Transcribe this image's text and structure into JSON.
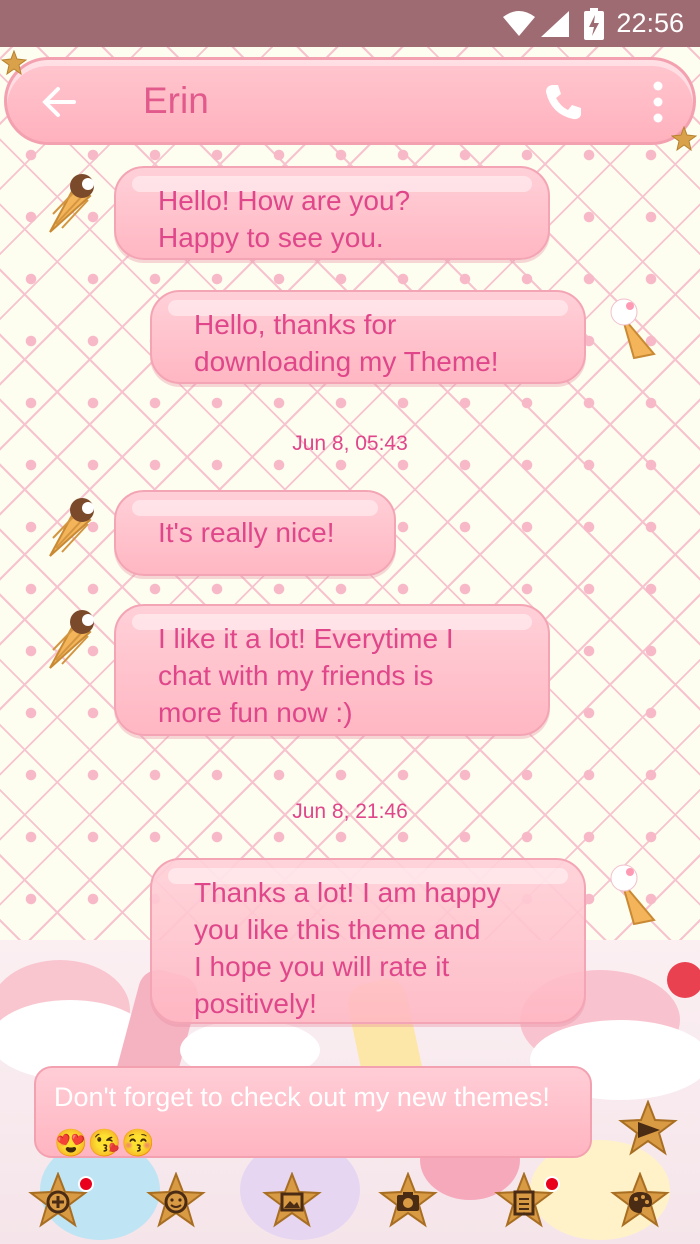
{
  "status_bar": {
    "time": "22:56"
  },
  "header": {
    "contact_name": "Erin"
  },
  "messages": [
    {
      "side": "incoming",
      "text": "Hello! How are you?\nHappy to see you."
    },
    {
      "side": "outgoing",
      "text": "Hello, thanks for\ndownloading my Theme!"
    },
    {
      "side": "incoming",
      "text": "It's really nice!"
    },
    {
      "side": "incoming",
      "text": "I like it a lot! Everytime I\nchat with my friends is\nmore fun now :)"
    },
    {
      "side": "outgoing",
      "text": "Thanks a lot! I am happy\nyou like this theme and\nI hope you will rate it\npositively!"
    }
  ],
  "timestamps": [
    "Jun 8, 05:43",
    "Jun 8, 21:46"
  ],
  "composer": {
    "text": "Don't forget to check out my new themes! 😍😘😚"
  },
  "toolbar": {
    "items": [
      "add-icon",
      "emoji-icon",
      "gallery-icon",
      "camera-icon",
      "notes-icon",
      "palette-icon"
    ]
  },
  "colors": {
    "status_bar": "#9e6b72",
    "accent_pink": "#e0468a",
    "bubble_pink": "#ffbcc7",
    "background": "#fdfdf0"
  }
}
